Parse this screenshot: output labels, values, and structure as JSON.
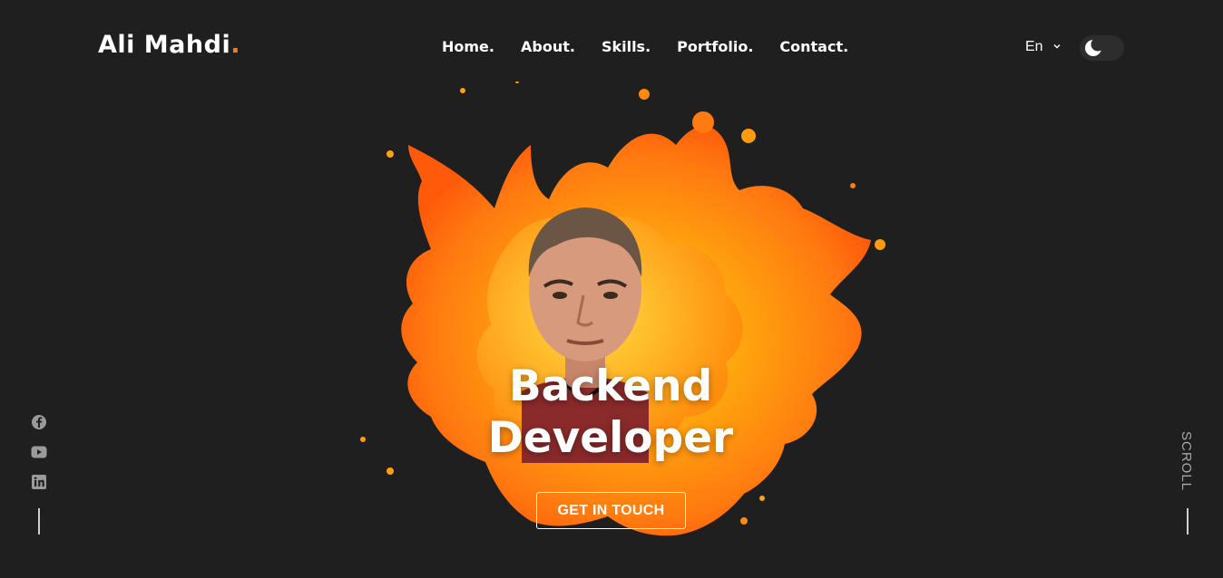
{
  "brand": {
    "name": "Ali Mahdi",
    "dot": "."
  },
  "nav": {
    "items": [
      {
        "label": "Home."
      },
      {
        "label": "About."
      },
      {
        "label": "Skills."
      },
      {
        "label": "Portfolio."
      },
      {
        "label": "Contact."
      }
    ]
  },
  "language": {
    "selected": "En",
    "icon": "chevron-down-icon"
  },
  "theme_toggle": {
    "icon": "moon-icon",
    "mode": "dark"
  },
  "hero": {
    "title_line1": "Backend",
    "title_line2": "Developer",
    "cta_label": "GET IN TOUCH"
  },
  "socials": [
    {
      "icon": "facebook-icon"
    },
    {
      "icon": "youtube-icon"
    },
    {
      "icon": "linkedin-icon"
    }
  ],
  "scroll": {
    "label": "SCROLL"
  },
  "colors": {
    "background": "#1f1f1f",
    "accent": "#ff7a1a",
    "splash": "#ff9a0f"
  }
}
